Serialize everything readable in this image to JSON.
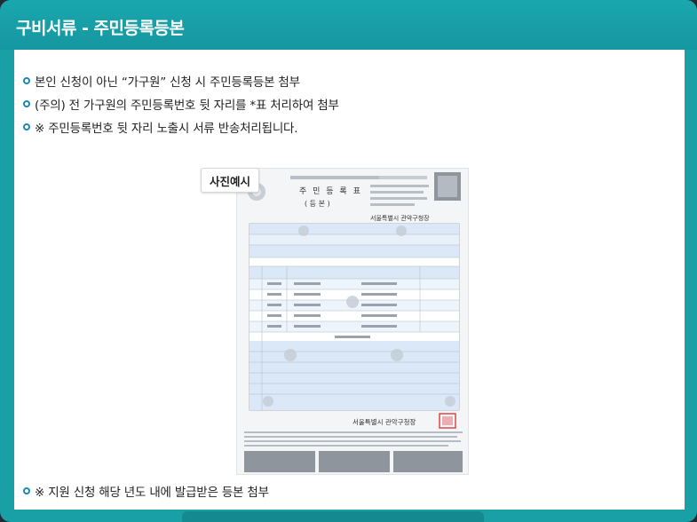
{
  "modal": {
    "title": "구비서류 - 주민등록등본"
  },
  "bullets": [
    "본인 신청이 아닌 “가구원” 신청 시 주민등록등본 첨부",
    "(주의) 전 가구원의 주민등록번호 뒷 자리를 *표 처리하여 첨부",
    "※ 주민등록번호 뒷 자리 노출시 서류 반송처리됩니다."
  ],
  "sample": {
    "photo_tag": "사진예시",
    "doc_title": "주 민 등 록 표",
    "doc_subtitle": "( 등     본 )",
    "issuer": "서울특별시 관악구청장",
    "issuer_bottom": "서울특별시 관악구청장"
  },
  "footer_bullet": "※ 지원 신청 해당 년도 내에 발급받은 등본 첨부",
  "colors": {
    "header": "#1aa7ae",
    "bullet_ring": "#1d86b5",
    "stamp": "#d94a4a",
    "table_row": "#dbe8f7"
  }
}
